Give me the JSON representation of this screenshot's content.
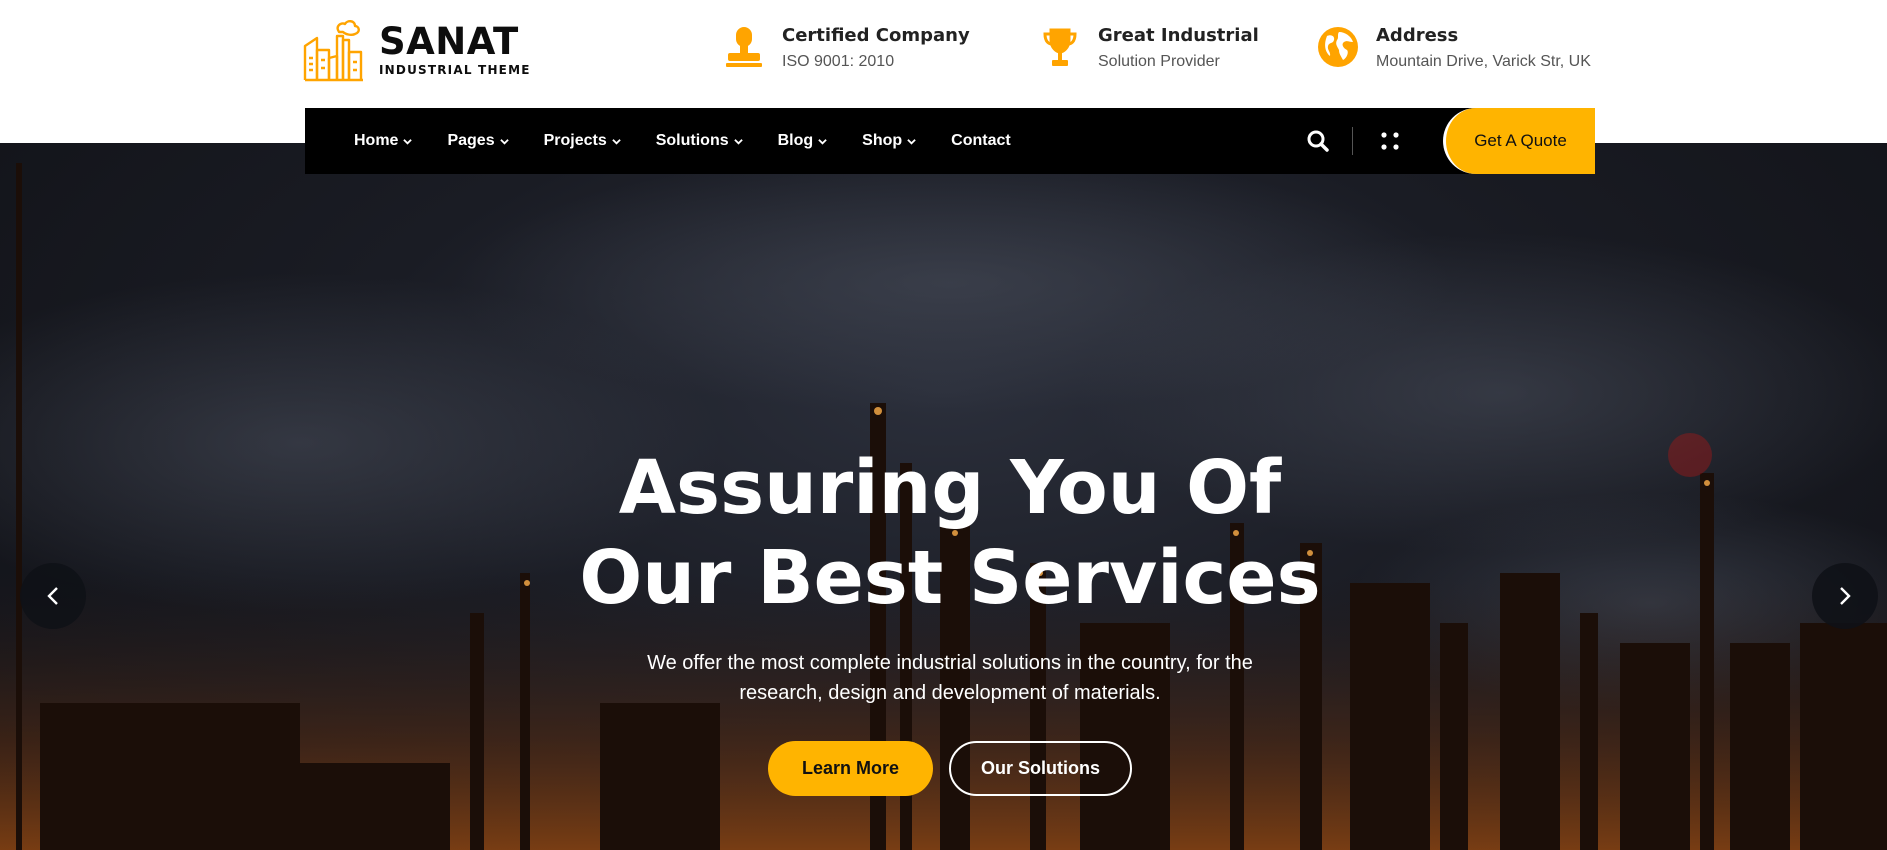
{
  "brand": {
    "name": "SANAT",
    "tagline": "INDUSTRIAL THEME"
  },
  "info": [
    {
      "icon": "stamp-icon",
      "title": "Certified Company",
      "subtitle": "ISO 9001: 2010"
    },
    {
      "icon": "trophy-icon",
      "title": "Great Industrial",
      "subtitle": "Solution Provider"
    },
    {
      "icon": "globe-icon",
      "title": "Address",
      "subtitle": "Mountain Drive, Varick Str, UK"
    }
  ],
  "nav": {
    "items": [
      {
        "label": "Home",
        "dropdown": true
      },
      {
        "label": "Pages",
        "dropdown": true
      },
      {
        "label": "Projects",
        "dropdown": true
      },
      {
        "label": "Solutions",
        "dropdown": true
      },
      {
        "label": "Blog",
        "dropdown": true
      },
      {
        "label": "Shop",
        "dropdown": true
      },
      {
        "label": "Contact",
        "dropdown": false
      }
    ],
    "quote_label": "Get A Quote"
  },
  "hero": {
    "title_line1": "Assuring You Of",
    "title_line2": "Our Best Services",
    "subtitle_line1": "We offer the most complete industrial solutions in the country, for the",
    "subtitle_line2": "research, design and development of materials.",
    "primary_button": "Learn More",
    "secondary_button": "Our Solutions"
  },
  "colors": {
    "accent": "#ffb400",
    "nav_bg": "#000000",
    "text_dark": "#222222"
  }
}
